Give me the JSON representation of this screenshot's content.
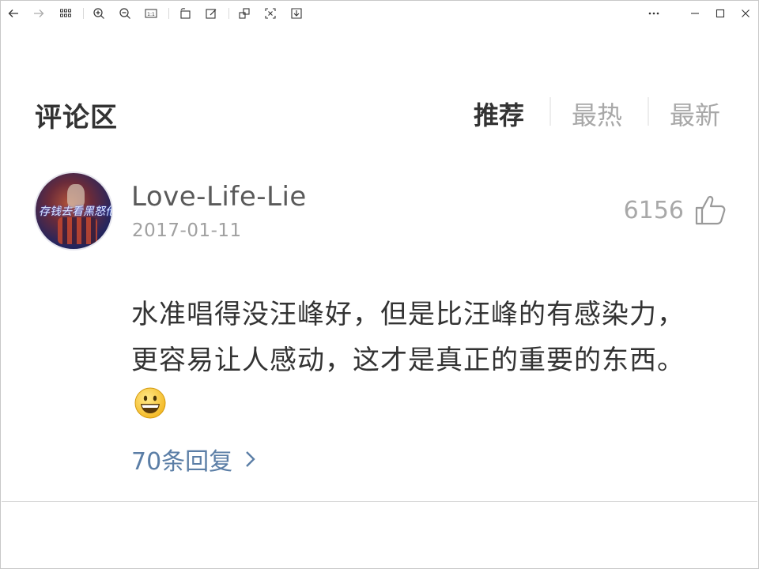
{
  "viewer_toolbar": {
    "buttons": [
      {
        "name": "back-arrow-icon"
      },
      {
        "name": "forward-arrow-icon"
      },
      {
        "name": "grid-view-icon"
      },
      {
        "name": "zoom-in-icon"
      },
      {
        "name": "zoom-out-icon"
      },
      {
        "name": "actual-size-icon",
        "label": "1:1"
      },
      {
        "name": "rotate-icon"
      },
      {
        "name": "edit-icon"
      },
      {
        "name": "crop-icon"
      },
      {
        "name": "fullscreen-icon"
      },
      {
        "name": "save-icon"
      }
    ],
    "window_controls": [
      "more-icon",
      "minimize-icon",
      "maximize-icon",
      "close-icon"
    ]
  },
  "comments_section": {
    "title": "评论区",
    "tabs": [
      {
        "label": "推荐",
        "active": true
      },
      {
        "label": "最热",
        "active": false
      },
      {
        "label": "最新",
        "active": false
      }
    ],
    "comment": {
      "avatar_text": "存钱去看黑怒伦",
      "username": "Love-Life-Lie",
      "date": "2017-01-11",
      "likes": "6156",
      "text_line1": "水准唱得没汪峰好，但是比汪峰的有感染力，",
      "text_line2": "更容易让人感动，这才是真正的重要的东西。",
      "emoji": "grinning-face",
      "replies_label": "70条回复"
    }
  },
  "colors": {
    "title": "#333333",
    "inactive_tab": "#a8a8a8",
    "username": "#5a5a5a",
    "date": "#a0a0a0",
    "reply_link": "#5b7ea6"
  }
}
